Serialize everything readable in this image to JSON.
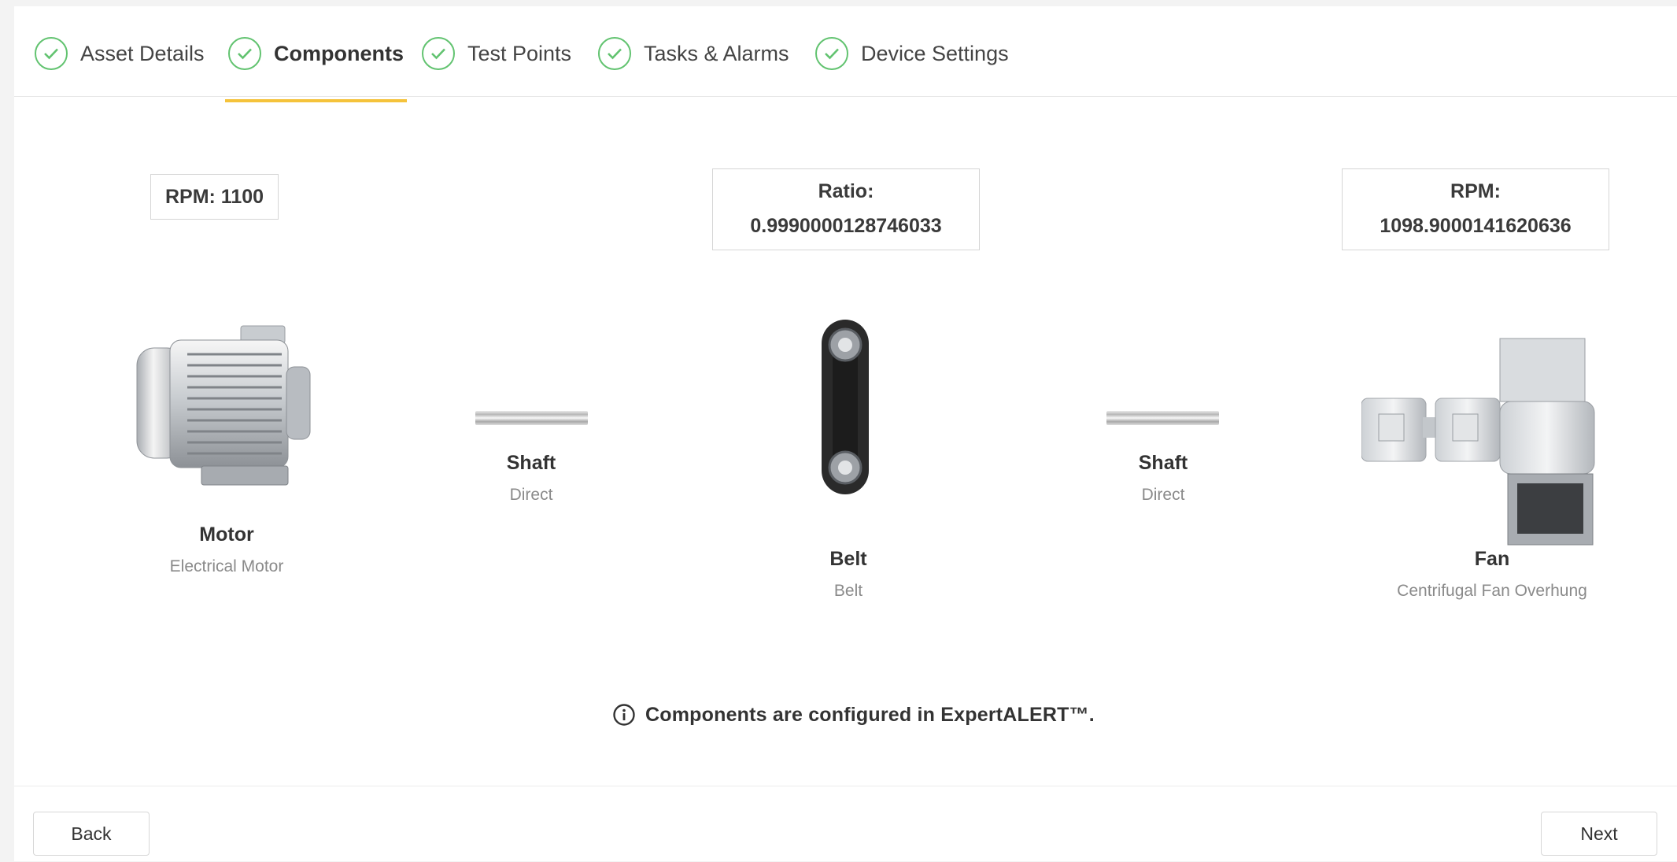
{
  "tabs": [
    {
      "label": "Asset Details",
      "completed": true
    },
    {
      "label": "Components",
      "completed": true,
      "active": true
    },
    {
      "label": "Test Points",
      "completed": true
    },
    {
      "label": "Tasks & Alarms",
      "completed": true
    },
    {
      "label": "Device Settings",
      "completed": true
    }
  ],
  "info_boxes": {
    "motor_rpm": "RPM: 1100",
    "belt_ratio_label": "Ratio:",
    "belt_ratio_value": "0.9990000128746033",
    "fan_rpm_label": "RPM:",
    "fan_rpm_value": "1098.9000141620636"
  },
  "components": {
    "motor": {
      "name": "Motor",
      "type": "Electrical Motor"
    },
    "shaft1": {
      "name": "Shaft",
      "type": "Direct"
    },
    "belt": {
      "name": "Belt",
      "type": "Belt"
    },
    "shaft2": {
      "name": "Shaft",
      "type": "Direct"
    },
    "fan": {
      "name": "Fan",
      "type": "Centrifugal Fan Overhung"
    }
  },
  "note": "Components are configured in ExpertALERT™.",
  "footer": {
    "back_label": "Back",
    "next_label": "Next"
  },
  "colors": {
    "check_green": "#62c370",
    "active_underline": "#f5c33b"
  },
  "icons": {
    "tab_status": "check-circle-icon",
    "note": "info-circle-icon"
  }
}
